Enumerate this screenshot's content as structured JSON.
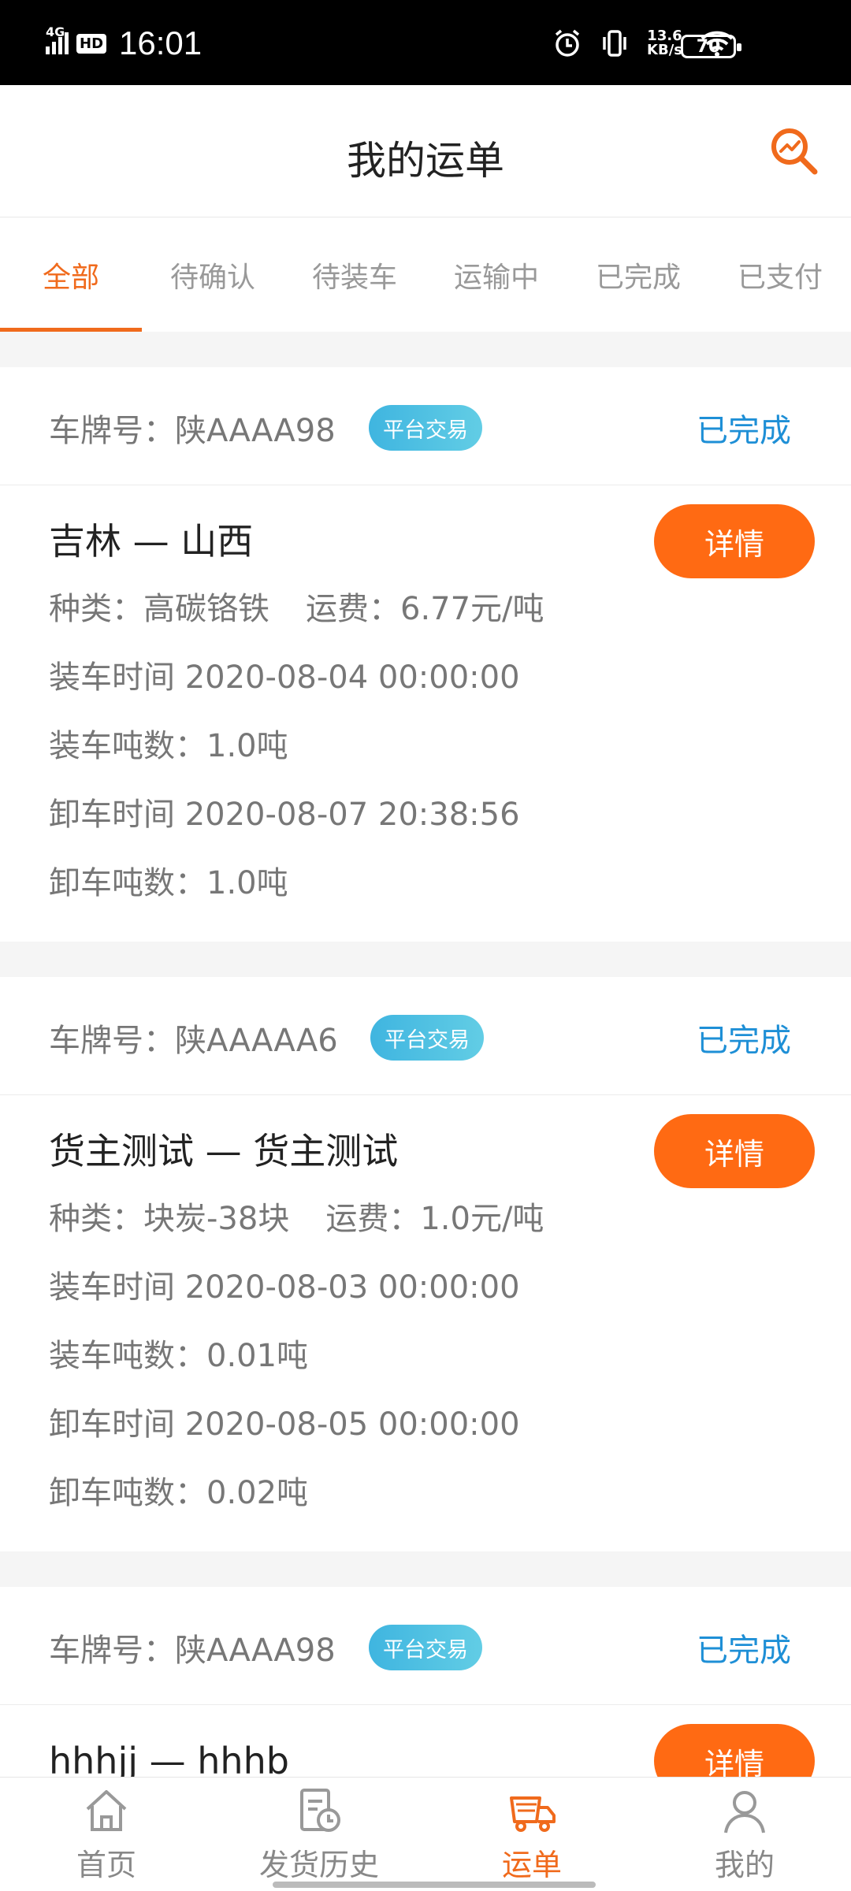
{
  "status_bar": {
    "network": "4G",
    "hd": "HD",
    "time": "16:01",
    "net_speed": "13.6",
    "net_unit": "KB/s",
    "battery": "70"
  },
  "header": {
    "title": "我的运单"
  },
  "tabs": [
    {
      "label": "全部",
      "active": true
    },
    {
      "label": "待确认"
    },
    {
      "label": "待装车"
    },
    {
      "label": "运输中"
    },
    {
      "label": "已完成"
    },
    {
      "label": "已支付"
    }
  ],
  "orders": [
    {
      "plate": "车牌号：陕AAAA98",
      "badge": "平台交易",
      "status": "已完成",
      "route": "吉林 — 山西",
      "category": "种类：高碳铬铁",
      "freight": "运费：6.77元/吨",
      "load_time": "装车时间 2020-08-04 00:00:00",
      "load_tons": "装车吨数：1.0吨",
      "unload_time": "卸车时间 2020-08-07 20:38:56",
      "unload_tons": "卸车吨数：1.0吨",
      "detail": "详情"
    },
    {
      "plate": "车牌号：陕AAAAA6",
      "badge": "平台交易",
      "status": "已完成",
      "route": "货主测试 — 货主测试",
      "category": "种类：块炭-38块",
      "freight": "运费：1.0元/吨",
      "load_time": "装车时间 2020-08-03 00:00:00",
      "load_tons": "装车吨数：0.01吨",
      "unload_time": "卸车时间 2020-08-05 00:00:00",
      "unload_tons": "卸车吨数：0.02吨",
      "detail": "详情"
    },
    {
      "plate": "车牌号：陕AAAA98",
      "badge": "平台交易",
      "status": "已完成",
      "route": "hhhjj — hhhb",
      "detail": "详情"
    }
  ],
  "bottom_nav": [
    {
      "label": "首页",
      "icon": "home-icon"
    },
    {
      "label": "发货历史",
      "icon": "history-icon"
    },
    {
      "label": "运单",
      "icon": "truck-icon",
      "active": true
    },
    {
      "label": "我的",
      "icon": "user-icon"
    }
  ],
  "colors": {
    "accent": "#f06a1c",
    "button": "#ff6a13",
    "status": "#1e8fd6",
    "badge": "#3fb5e0"
  }
}
